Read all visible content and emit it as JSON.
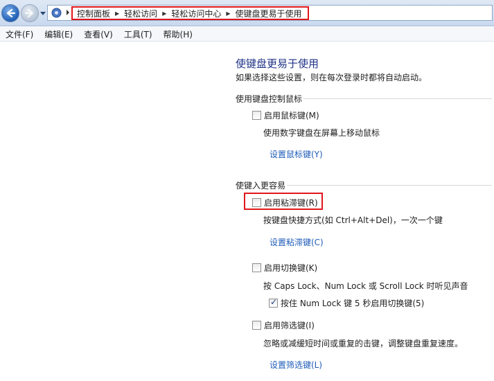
{
  "breadcrumb": {
    "items": [
      "控制面板",
      "轻松访问",
      "轻松访问中心",
      "使键盘更易于使用"
    ],
    "separator": "▶"
  },
  "menu": [
    "文件(F)",
    "编辑(E)",
    "查看(V)",
    "工具(T)",
    "帮助(H)"
  ],
  "page": {
    "title": "使键盘更易于使用",
    "description": "如果选择这些设置，则在每次登录时都将自动启动。"
  },
  "mouse_group": {
    "title": "使用键盘控制鼠标",
    "mouse_keys": {
      "label": "启用鼠标键(M)",
      "checked": false
    },
    "mouse_keys_desc": "使用数字键盘在屏幕上移动鼠标",
    "mouse_keys_link": "设置鼠标键(Y)"
  },
  "typing_group": {
    "title": "使键入更容易",
    "sticky_keys": {
      "label": "启用粘滞键(R)",
      "checked": false
    },
    "sticky_keys_desc": "按键盘快捷方式(如 Ctrl+Alt+Del)，一次一个键",
    "sticky_keys_link": "设置粘滞键(C)",
    "toggle_keys": {
      "label": "启用切换键(K)",
      "checked": false
    },
    "toggle_keys_desc": "按 Caps Lock、Num Lock 或 Scroll Lock 时听见声音",
    "toggle_numlock": {
      "label": "按住 Num Lock 键 5 秒启用切换键(5)",
      "checked": true
    },
    "filter_keys": {
      "label": "启用筛选键(I)",
      "checked": false
    },
    "filter_keys_desc": "忽略或减缓短时间或重复的击键，调整键盘重复速度。",
    "filter_keys_link": "设置筛选键(L)"
  },
  "colors": {
    "title": "#1e3287",
    "link": "#1e5bb8",
    "highlight": "#e0161b"
  }
}
